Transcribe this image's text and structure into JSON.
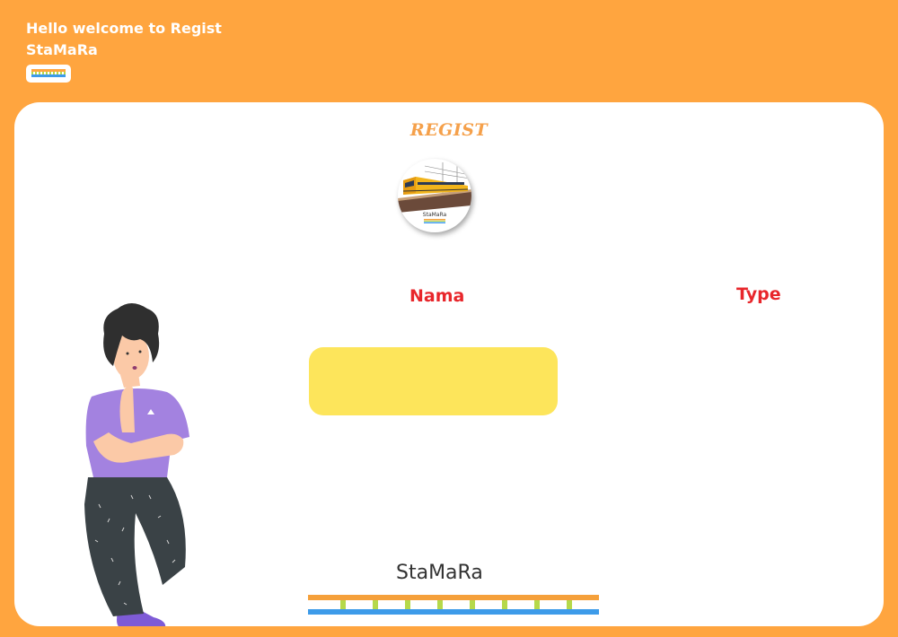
{
  "header": {
    "welcome": "Hello welcome to Regist",
    "app_name": "StaMaRa",
    "logo_icon": "stamara-rail-logo-icon"
  },
  "card": {
    "title": "REGIST",
    "circle_logo_icon": "train-station-logo-icon",
    "circle_logo_text": "StaMaRa",
    "illustration": "thinking-person-illustration"
  },
  "form": {
    "nama_label": "Nama",
    "type_label": "Type",
    "nama_value": "",
    "nama_placeholder": ""
  },
  "footer": {
    "brand": "StaMaRa",
    "rail_icon": "rail-track-icon"
  },
  "colors": {
    "background": "#FFA53F",
    "card": "#FFFFFF",
    "title": "#F5A04A",
    "label": "#E8262B",
    "input": "#FDE55B",
    "rail_orange": "#F5A03A",
    "rail_blue": "#3D9BE9",
    "rail_ties": "#B5D94A"
  }
}
